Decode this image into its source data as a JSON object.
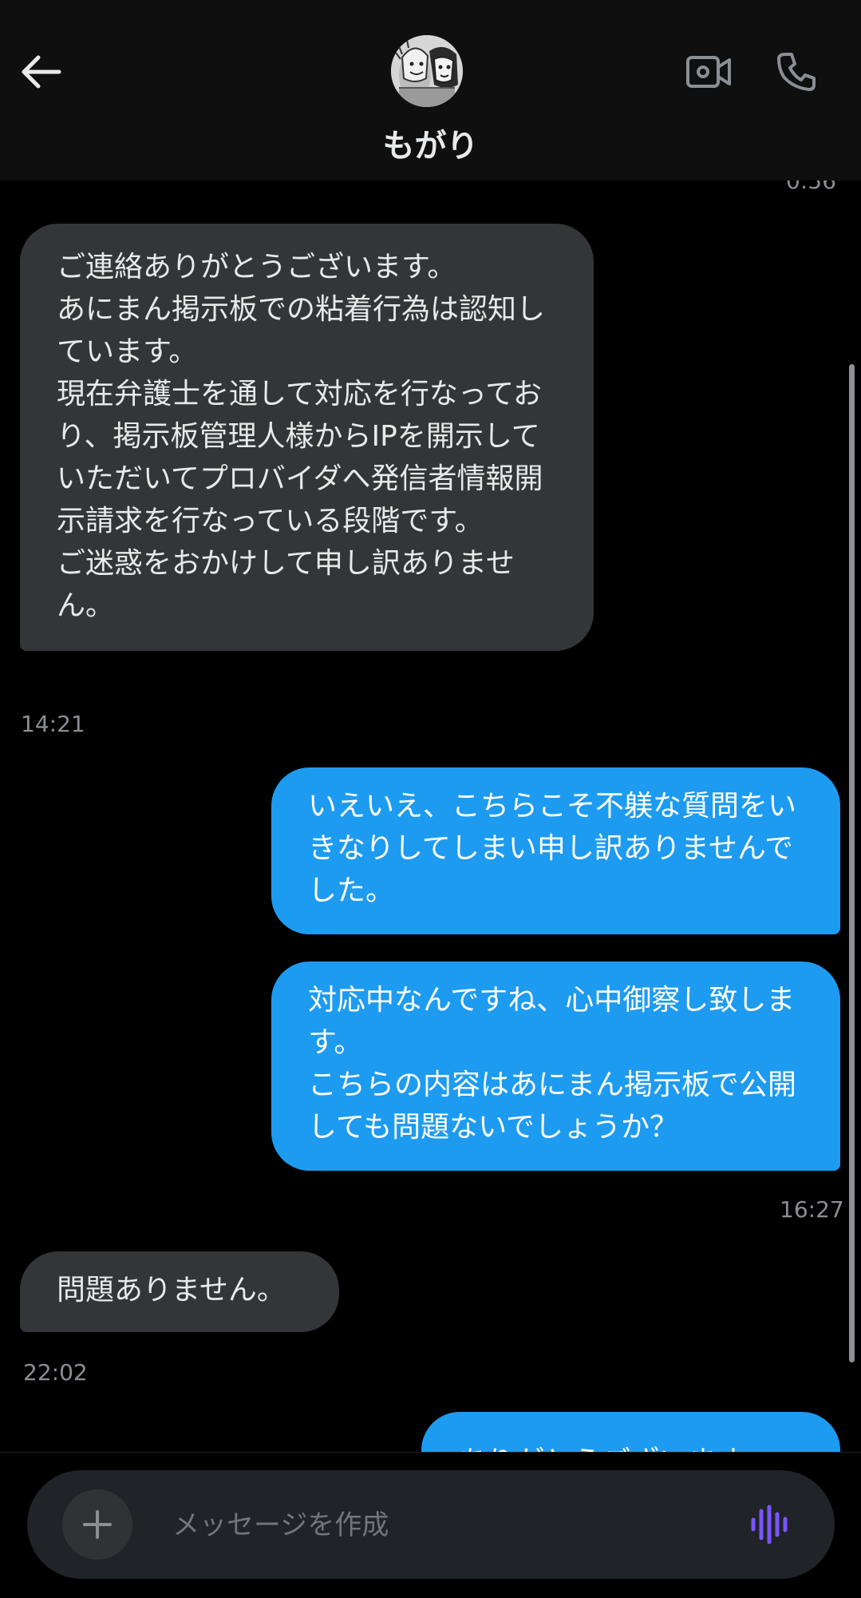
{
  "header": {
    "contact_name": "もがり"
  },
  "colors": {
    "incoming_bubble": "#333539",
    "outgoing_bubble": "#1d9bf0",
    "accent_voice": "#7856ff"
  },
  "icons": {
    "back": "arrow-left-icon",
    "video": "video-camera-icon",
    "phone": "phone-icon",
    "add": "plus-icon",
    "voice": "voice-waveform-icon"
  },
  "conversation": {
    "top_partial_time": "0:56",
    "messages": [
      {
        "direction": "in",
        "text": "ご連絡ありがとうございます。\nあにまん掲示板での粘着行為は認知しています。\n現在弁護士を通して対応を行なっており、掲示板管理人様からIPを開示していただいてプロバイダへ発信者情報開示請求を行なっている段階です。\nご迷惑をおかけして申し訳ありません。",
        "time": "14:21"
      },
      {
        "direction": "out",
        "text": "いえいえ、こちらこそ不躾な質問をいきなりしてしまい申し訳ありませんでした。"
      },
      {
        "direction": "out",
        "text": "対応中なんですね、心中御察し致します。\nこちらの内容はあにまん掲示板で公開しても問題ないでしょうか？",
        "time": "16:27"
      },
      {
        "direction": "in",
        "text": "問題ありません。",
        "time": "22:02"
      },
      {
        "direction": "out",
        "text": "ありがとうございます"
      }
    ]
  },
  "composer": {
    "placeholder": "メッセージを作成"
  }
}
